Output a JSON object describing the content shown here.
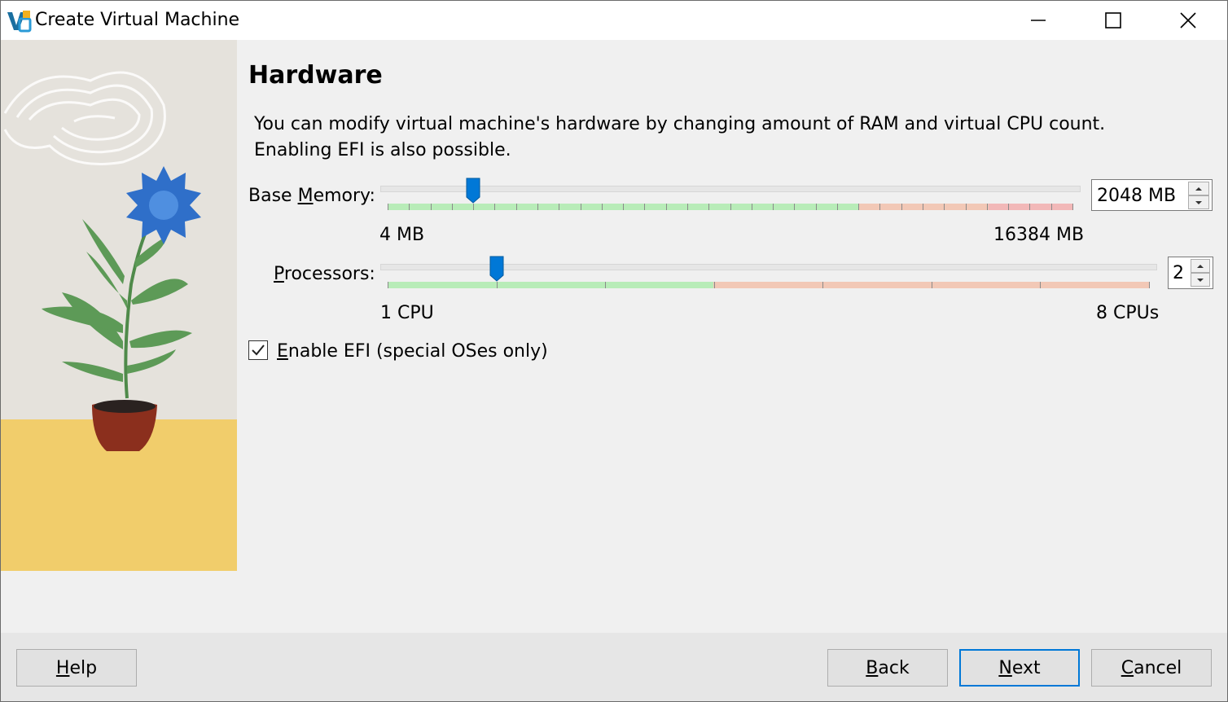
{
  "window": {
    "title": "Create Virtual Machine"
  },
  "page": {
    "heading": "Hardware",
    "description_line1": "You can modify virtual machine's hardware by changing amount of RAM and virtual CPU count.",
    "description_line2": "Enabling EFI is also possible."
  },
  "memory": {
    "label_prefix": "Base ",
    "label_mnemonic": "M",
    "label_suffix": "emory:",
    "min_label": "4 MB",
    "max_label": "16384 MB",
    "value": "2048 MB",
    "value_fraction": 0.125
  },
  "processors": {
    "label_mnemonic": "P",
    "label_suffix": "rocessors:",
    "min_label": "1 CPU",
    "max_label": "8 CPUs",
    "value": "2",
    "value_fraction": 0.143
  },
  "efi": {
    "label_mnemonic": "E",
    "label_suffix": "nable EFI (special OSes only)",
    "checked": true
  },
  "buttons": {
    "help_mnemonic": "H",
    "help_suffix": "elp",
    "back_mnemonic": "B",
    "back_suffix": "ack",
    "next_mnemonic": "N",
    "next_suffix": "ext",
    "cancel_mnemonic": "C",
    "cancel_suffix": "ancel"
  },
  "colors": {
    "accent": "#0078d7",
    "zone_ok": "#b8ecb8",
    "zone_warn": "#f2c8b6",
    "zone_bad": "#f2b8b8"
  }
}
